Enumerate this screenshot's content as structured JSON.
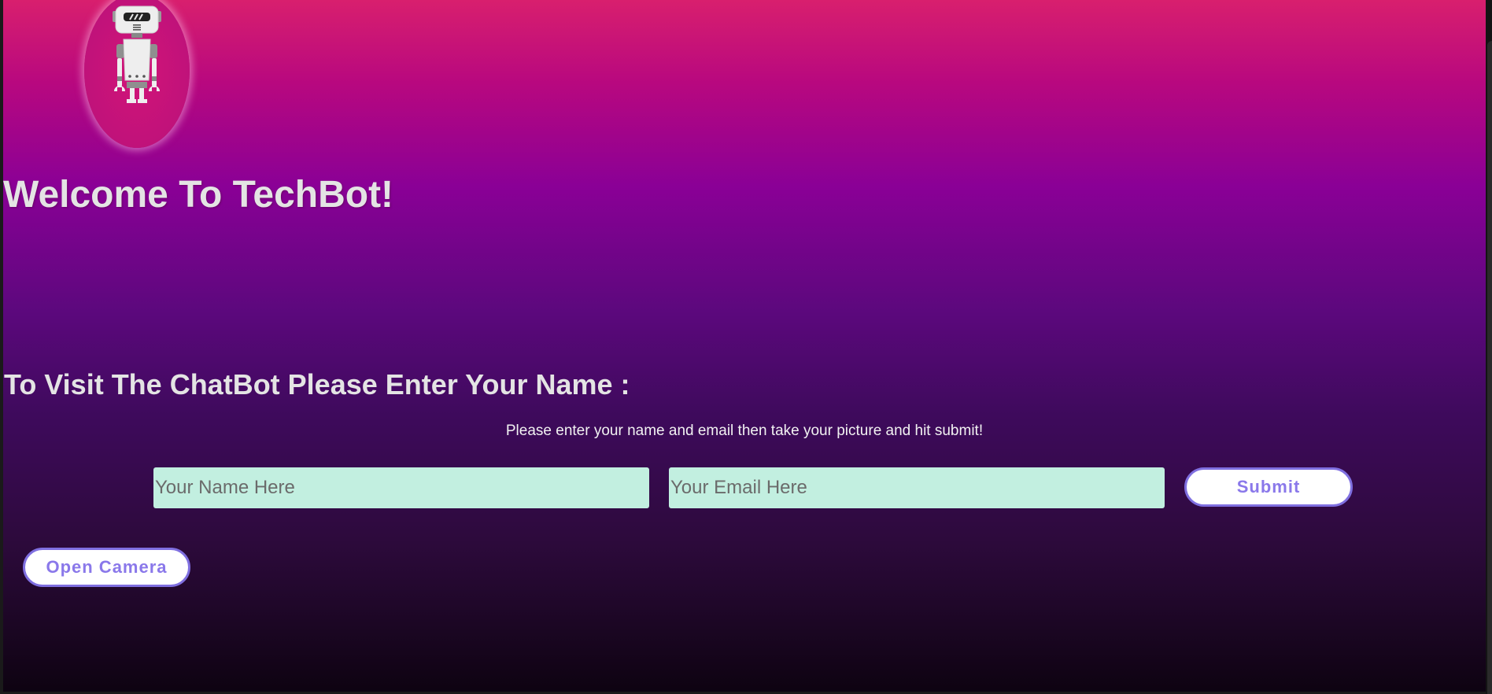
{
  "header": {
    "logo_icon": "robot-icon",
    "welcome_title": "Welcome To TechBot!"
  },
  "form": {
    "heading": "To Visit The ChatBot Please Enter Your Name :",
    "instructions": "Please enter your name and email then take your picture and hit submit!",
    "name_placeholder": "Your Name Here",
    "email_placeholder": "Your Email Here",
    "submit_label": "Submit",
    "camera_label": "Open Camera"
  },
  "colors": {
    "gradient_top": "#d81f6e",
    "gradient_mid": "#8a0096",
    "gradient_bottom": "#0e0311",
    "input_background": "#c2efe0",
    "button_accent": "#7f6fe0"
  }
}
